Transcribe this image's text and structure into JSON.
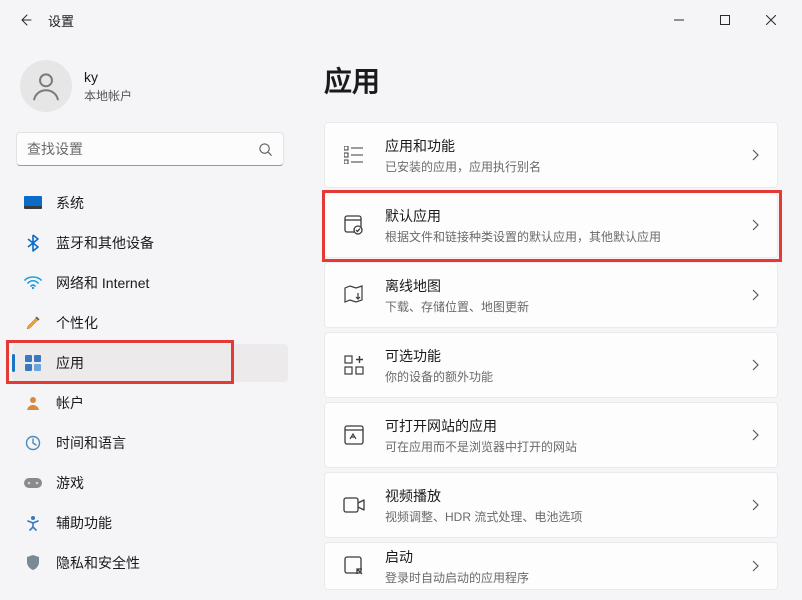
{
  "titlebar": {
    "title": "设置"
  },
  "profile": {
    "name": "ky",
    "sub": "本地帐户"
  },
  "search": {
    "placeholder": "查找设置"
  },
  "sidebar": {
    "items": [
      {
        "label": "系统"
      },
      {
        "label": "蓝牙和其他设备"
      },
      {
        "label": "网络和 Internet"
      },
      {
        "label": "个性化"
      },
      {
        "label": "应用"
      },
      {
        "label": "帐户"
      },
      {
        "label": "时间和语言"
      },
      {
        "label": "游戏"
      },
      {
        "label": "辅助功能"
      },
      {
        "label": "隐私和安全性"
      }
    ]
  },
  "page": {
    "title": "应用"
  },
  "cards": [
    {
      "title": "应用和功能",
      "sub": "已安装的应用，应用执行别名"
    },
    {
      "title": "默认应用",
      "sub": "根据文件和链接种类设置的默认应用，其他默认应用"
    },
    {
      "title": "离线地图",
      "sub": "下载、存储位置、地图更新"
    },
    {
      "title": "可选功能",
      "sub": "你的设备的额外功能"
    },
    {
      "title": "可打开网站的应用",
      "sub": "可在应用而不是浏览器中打开的网站"
    },
    {
      "title": "视频播放",
      "sub": "视频调整、HDR 流式处理、电池选项"
    },
    {
      "title": "启动",
      "sub": "登录时自动启动的应用程序"
    }
  ]
}
